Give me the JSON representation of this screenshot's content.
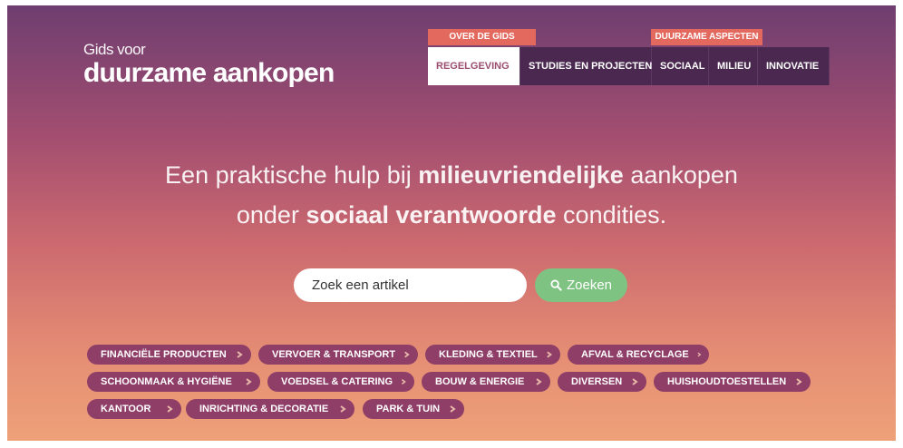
{
  "logo": {
    "line1": "Gids voor",
    "line2": "duurzame aankopen"
  },
  "topbar": {
    "categories": [
      {
        "label": "OVER DE GIDS"
      },
      {
        "label": "DUURZAME ASPECTEN"
      }
    ],
    "nav": [
      {
        "label": "REGELGEVING",
        "active": true
      },
      {
        "label": "STUDIES EN PROJECTEN"
      },
      {
        "label": "SOCIAAL"
      },
      {
        "label": "MILIEU"
      },
      {
        "label": "INNOVATIE"
      }
    ]
  },
  "headline": {
    "line1": {
      "pre": "Een praktische hulp bij ",
      "bold": "milieuvriendelijke",
      "post": " aankopen"
    },
    "line2": {
      "pre": "onder ",
      "bold": "sociaal verantwoorde",
      "post": " condities."
    }
  },
  "search": {
    "placeholder": "Zoek een artikel",
    "button": "Zoeken"
  },
  "categories": [
    "FINANCIËLE PRODUCTEN",
    "VERVOER & TRANSPORT",
    "KLEDING & TEXTIEL",
    "AFVAL & RECYCLAGE",
    "SCHOONMAAK & HYGIËNE",
    "VOEDSEL & CATERING",
    "BOUW & ENERGIE",
    "DIVERSEN",
    "HUISHOUDTOESTELLEN",
    "KANTOOR",
    "INRICHTING & DECORATIE",
    "PARK & TUIN"
  ],
  "colors": {
    "accent": "#e3695f",
    "nav_bg": "#4a2850",
    "pill_bg": "#8f3e68",
    "search_button": "#7ec382",
    "gradient_top": "#6e3e70",
    "gradient_bottom": "#eea179"
  },
  "icons": {
    "search": "search-icon",
    "pill_arrow": "chevron-right-icon"
  }
}
